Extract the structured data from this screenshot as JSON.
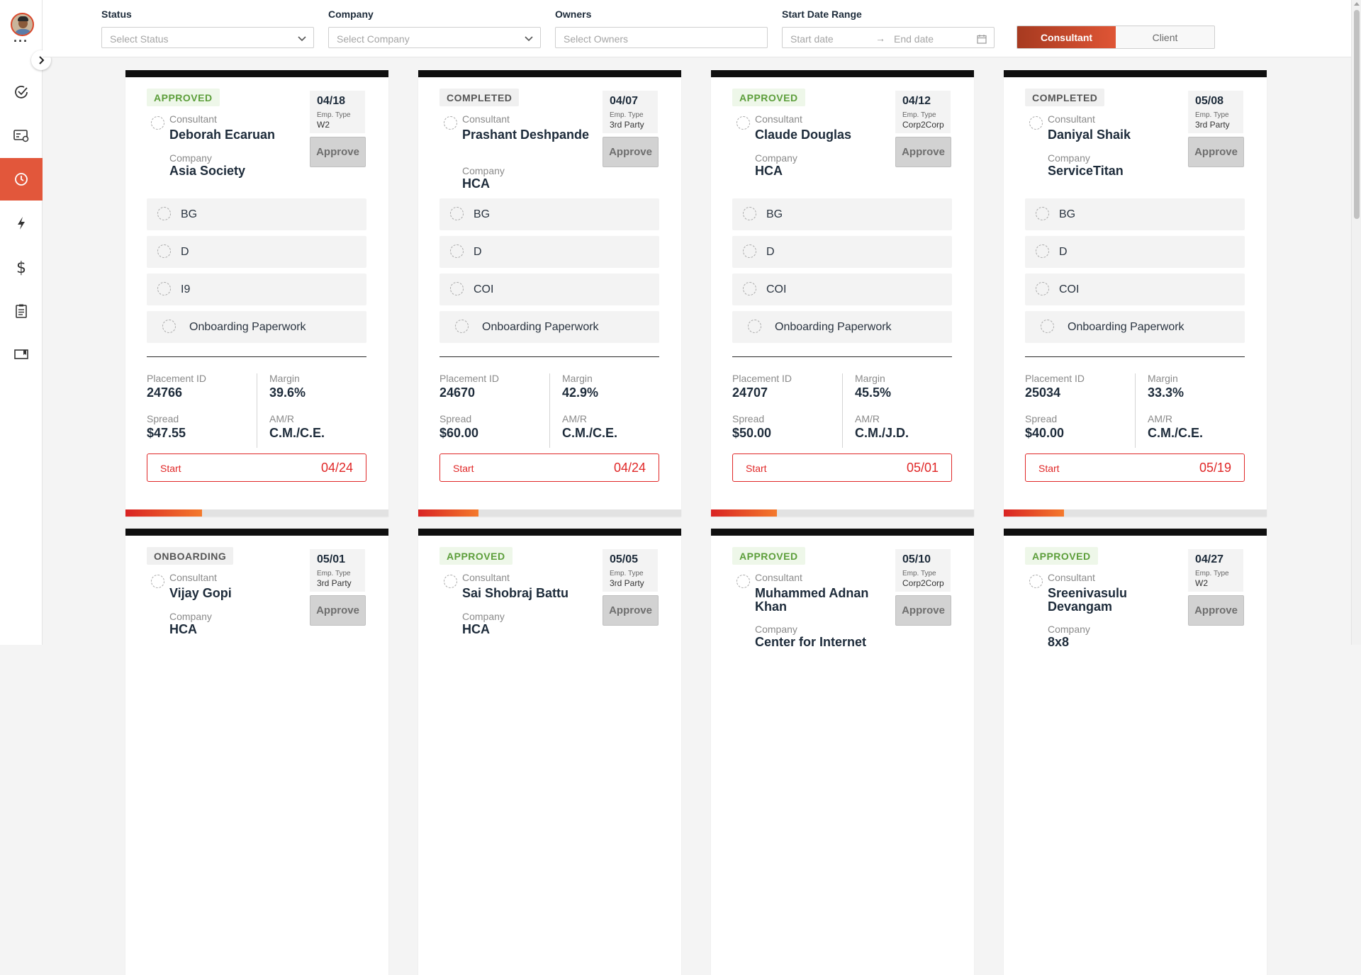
{
  "filters": {
    "status": {
      "label": "Status",
      "placeholder": "Select Status"
    },
    "company": {
      "label": "Company",
      "placeholder": "Select Company"
    },
    "owners": {
      "label": "Owners",
      "placeholder": "Select Owners"
    },
    "date_range": {
      "label": "Start Date Range",
      "start_placeholder": "Start date",
      "end_placeholder": "End date"
    },
    "toggle": {
      "consultant": "Consultant",
      "client": "Client",
      "selected": "Consultant"
    }
  },
  "sidebar": {
    "items": [
      {
        "icon": "check-circle-icon",
        "active": false
      },
      {
        "icon": "id-card-icon",
        "active": false
      },
      {
        "icon": "clock-icon",
        "active": true
      },
      {
        "icon": "lightning-icon",
        "active": false
      },
      {
        "icon": "dollar-icon",
        "active": false
      },
      {
        "icon": "clipboard-icon",
        "active": false
      },
      {
        "icon": "book-icon",
        "active": false
      }
    ]
  },
  "labels": {
    "consultant": "Consultant",
    "company": "Company",
    "emp_type": "Emp. Type",
    "approve": "Approve",
    "placement_id": "Placement ID",
    "margin": "Margin",
    "spread": "Spread",
    "amr": "AM/R",
    "start": "Start"
  },
  "cards": [
    {
      "status": "APPROVED",
      "status_kind": "approved",
      "date": "04/18",
      "emp_type": "W2",
      "consultant": "Deborah Ecaruan",
      "company": "Asia Society",
      "docs": [
        "BG",
        "D",
        "I9",
        "Onboarding Paperwork"
      ],
      "placement_id": "24766",
      "margin": "39.6%",
      "spread": "$47.55",
      "amr": "C.M./C.E.",
      "start": "04/24",
      "progress": 0.29
    },
    {
      "status": "COMPLETED",
      "status_kind": "completed",
      "date": "04/07",
      "emp_type": "3rd Party",
      "consultant": "Prashant Deshpande",
      "company": "HCA",
      "docs": [
        "BG",
        "D",
        "COI",
        "Onboarding Paperwork"
      ],
      "placement_id": "24670",
      "margin": "42.9%",
      "spread": "$60.00",
      "amr": "C.M./C.E.",
      "start": "04/24",
      "progress": 0.23
    },
    {
      "status": "APPROVED",
      "status_kind": "approved",
      "date": "04/12",
      "emp_type": "Corp2Corp",
      "consultant": "Claude Douglas",
      "company": "HCA",
      "docs": [
        "BG",
        "D",
        "COI",
        "Onboarding Paperwork"
      ],
      "placement_id": "24707",
      "margin": "45.5%",
      "spread": "$50.00",
      "amr": "C.M./J.D.",
      "start": "05/01",
      "progress": 0.25
    },
    {
      "status": "COMPLETED",
      "status_kind": "completed",
      "date": "05/08",
      "emp_type": "3rd Party",
      "consultant": "Daniyal Shaik",
      "company": "ServiceTitan",
      "docs": [
        "BG",
        "D",
        "COI",
        "Onboarding Paperwork"
      ],
      "placement_id": "25034",
      "margin": "33.3%",
      "spread": "$40.00",
      "amr": "C.M./C.E.",
      "start": "05/19",
      "progress": 0.23
    },
    {
      "status": "ONBOARDING",
      "status_kind": "onboarding",
      "date": "05/01",
      "emp_type": "3rd Party",
      "consultant": "Vijay Gopi",
      "company": "HCA",
      "docs": [],
      "placement_id": "",
      "margin": "",
      "spread": "",
      "amr": "",
      "start": "",
      "progress": 0
    },
    {
      "status": "APPROVED",
      "status_kind": "approved",
      "date": "05/05",
      "emp_type": "3rd Party",
      "consultant": "Sai Shobraj Battu",
      "company": "HCA",
      "docs": [],
      "placement_id": "",
      "margin": "",
      "spread": "",
      "amr": "",
      "start": "",
      "progress": 0
    },
    {
      "status": "APPROVED",
      "status_kind": "approved",
      "date": "05/10",
      "emp_type": "Corp2Corp",
      "consultant": "Muhammed Adnan Khan",
      "company": "Center for Internet",
      "docs": [],
      "placement_id": "",
      "margin": "",
      "spread": "",
      "amr": "",
      "start": "",
      "progress": 0
    },
    {
      "status": "APPROVED",
      "status_kind": "approved",
      "date": "04/27",
      "emp_type": "W2",
      "consultant": "Sreenivasulu Devangam",
      "company": "8x8",
      "docs": [],
      "placement_id": "",
      "margin": "",
      "spread": "",
      "amr": "",
      "start": "",
      "progress": 0
    }
  ]
}
